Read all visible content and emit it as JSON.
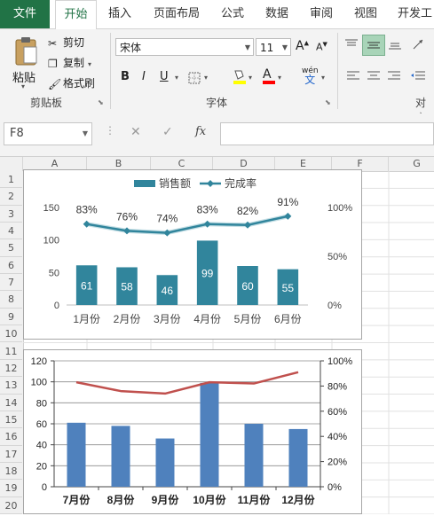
{
  "ribbon": {
    "tabs": [
      "文件",
      "开始",
      "插入",
      "页面布局",
      "公式",
      "数据",
      "审阅",
      "视图",
      "开发工"
    ],
    "clipboard": {
      "paste": "粘贴",
      "cut": "剪切",
      "copy": "复制",
      "format_painter": "格式刷",
      "group_label": "剪贴板"
    },
    "font": {
      "name": "宋体",
      "size": "11",
      "bold": "B",
      "italic": "I",
      "underline": "U",
      "wen": "wén",
      "wen_char": "文",
      "grow": "A",
      "shrink": "A",
      "font_color_glyph": "A",
      "group_label": "字体"
    },
    "align": {
      "group_label": "对齐"
    }
  },
  "formula_bar": {
    "name_box": "F8",
    "cancel": "✕",
    "enter": "✓",
    "fx": "fx",
    "formula": ""
  },
  "sheet": {
    "columns": [
      "A",
      "B",
      "C",
      "D",
      "E",
      "F",
      "G"
    ],
    "rows": [
      "1",
      "2",
      "3",
      "4",
      "5",
      "6",
      "7",
      "8",
      "9",
      "10",
      "11",
      "12",
      "13",
      "14",
      "15",
      "16",
      "17",
      "18",
      "19",
      "20"
    ]
  },
  "chart_data": [
    {
      "type": "bar+line",
      "categories": [
        "1月份",
        "2月份",
        "3月份",
        "4月份",
        "5月份",
        "6月份"
      ],
      "series": [
        {
          "name": "销售额",
          "type": "bar",
          "axis": "left",
          "values": [
            61,
            58,
            46,
            99,
            60,
            55
          ],
          "color": "#31859c"
        },
        {
          "name": "完成率",
          "type": "line",
          "axis": "right",
          "values": [
            83,
            76,
            74,
            83,
            82,
            91
          ],
          "color": "#31859c"
        }
      ],
      "bar_labels": [
        "61",
        "58",
        "46",
        "99",
        "60",
        "55"
      ],
      "line_labels": [
        "83%",
        "76%",
        "74%",
        "83%",
        "82%",
        "91%"
      ],
      "y_left": {
        "ticks": [
          "0",
          "50",
          "100",
          "150"
        ],
        "range": [
          0,
          150
        ]
      },
      "y_right": {
        "ticks": [
          "0%",
          "50%",
          "100%"
        ],
        "range": [
          0,
          100
        ]
      },
      "legend": "top-center",
      "grid": false
    },
    {
      "type": "bar+line",
      "categories": [
        "7月份",
        "8月份",
        "9月份",
        "10月份",
        "11月份",
        "12月份"
      ],
      "series": [
        {
          "type": "bar",
          "axis": "left",
          "values": [
            61,
            58,
            46,
            99,
            60,
            55
          ],
          "color": "#4f81bd"
        },
        {
          "type": "line",
          "axis": "right",
          "values": [
            83,
            76,
            74,
            83,
            82,
            91
          ],
          "color": "#c0504d"
        }
      ],
      "y_left": {
        "ticks": [
          "0",
          "20",
          "40",
          "60",
          "80",
          "100",
          "120"
        ],
        "range": [
          0,
          120
        ]
      },
      "y_right": {
        "ticks": [
          "0%",
          "20%",
          "40%",
          "60%",
          "80%",
          "100%"
        ],
        "range": [
          0,
          100
        ]
      },
      "grid": true
    }
  ]
}
